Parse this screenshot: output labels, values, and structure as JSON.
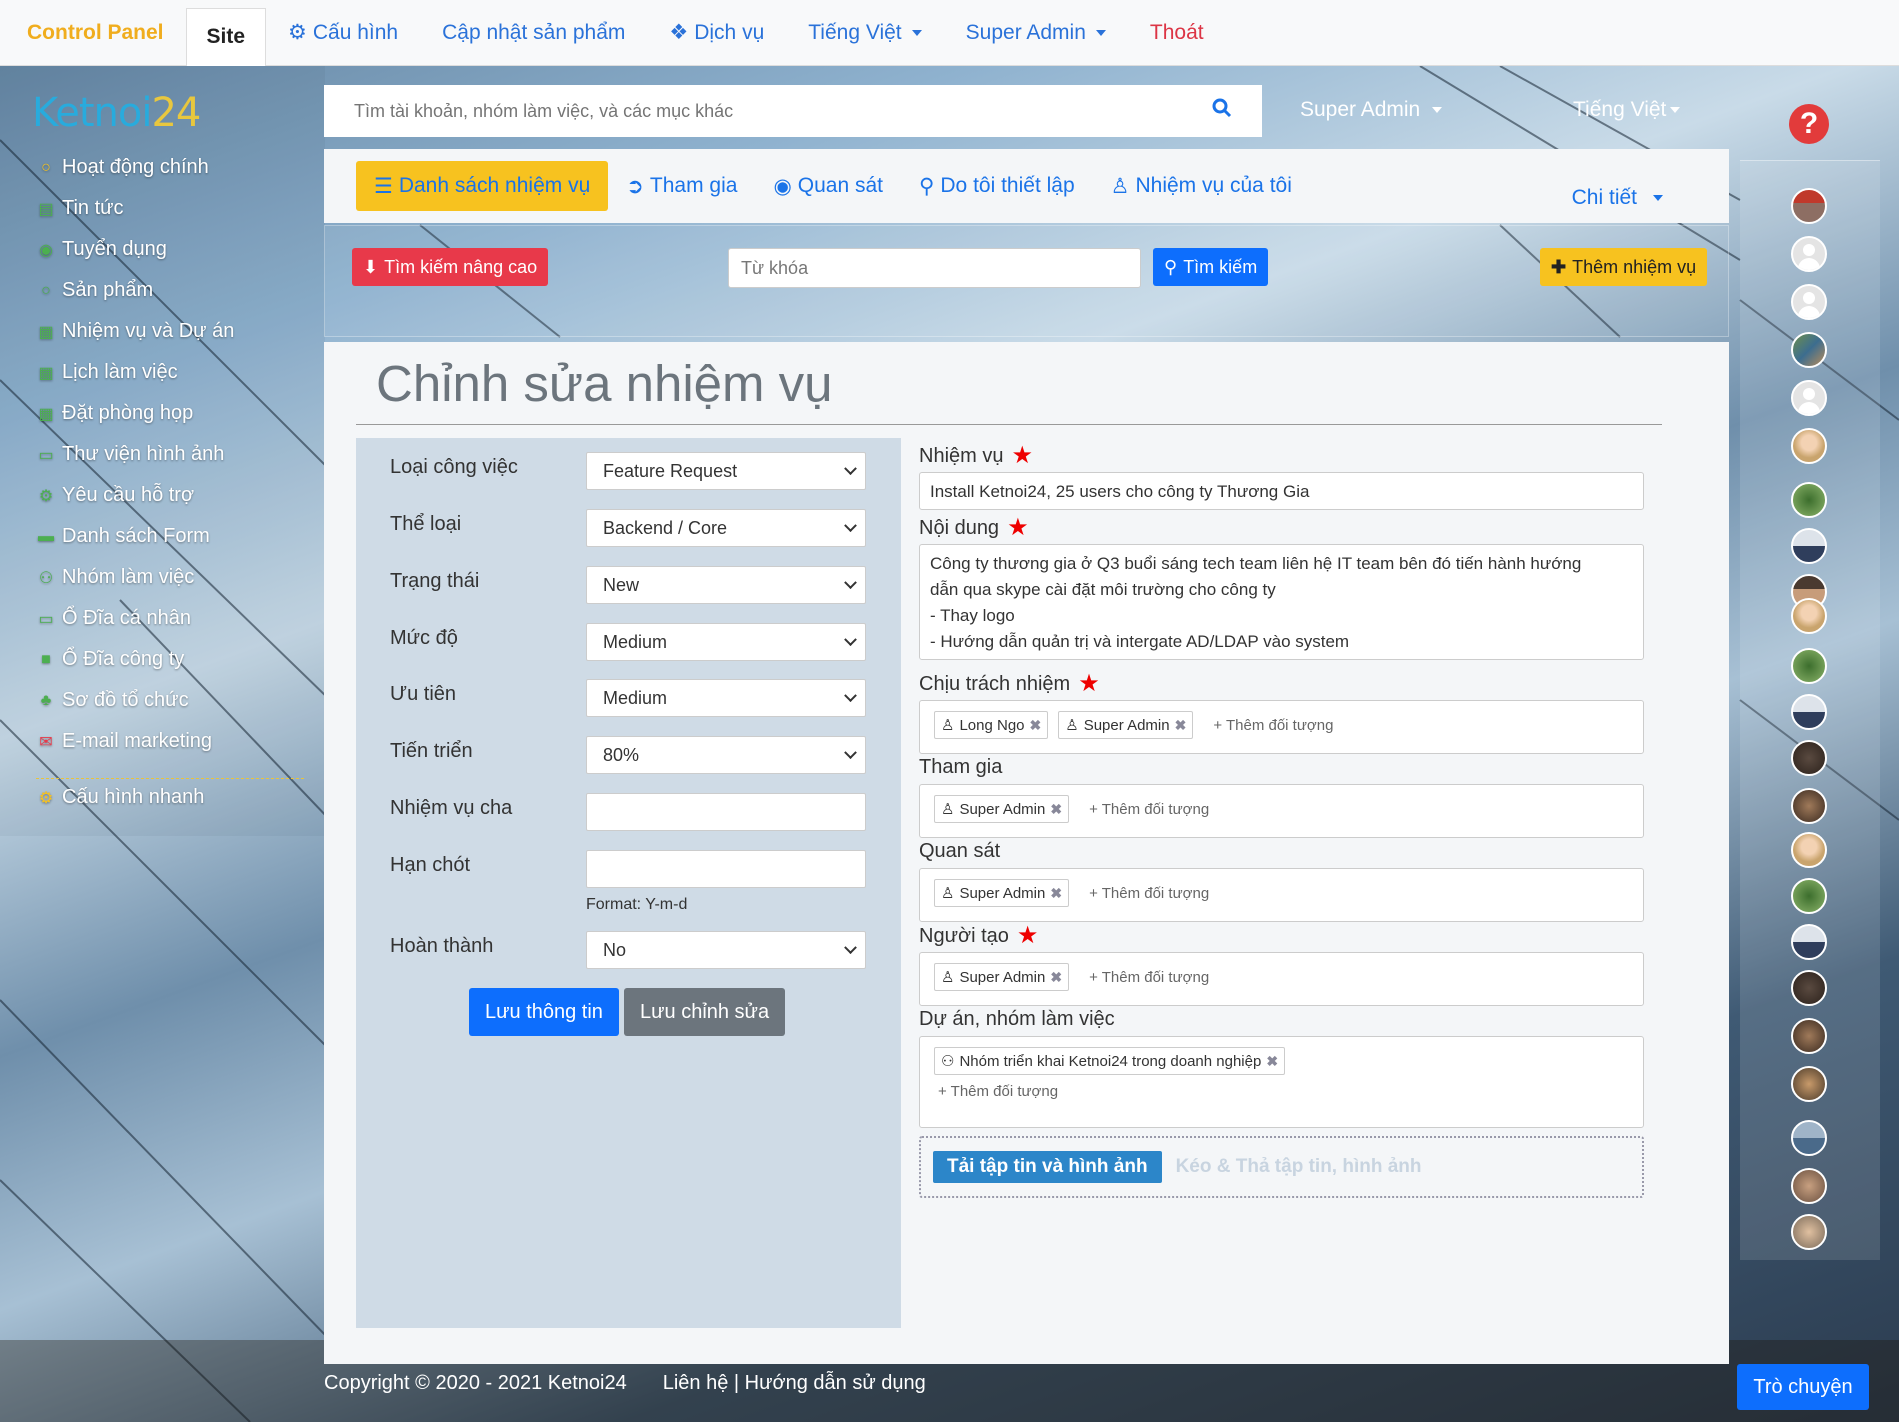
{
  "topnav": {
    "brand": "Control Panel",
    "items": [
      {
        "label": "Site"
      },
      {
        "label": "Cấu hình"
      },
      {
        "label": "Cập nhật sản phẩm"
      },
      {
        "label": "Dịch vụ"
      },
      {
        "label": "Tiếng Việt"
      },
      {
        "label": "Super Admin"
      },
      {
        "label": "Thoát"
      }
    ]
  },
  "logo": {
    "text": "Ketnoi",
    "num": "24"
  },
  "sidebar": {
    "items": [
      {
        "label": "Hoạt động chính",
        "icon": "circle-icon"
      },
      {
        "label": "Tin tức",
        "icon": "newspaper-icon"
      },
      {
        "label": "Tuyển dụng",
        "icon": "user-circle-icon"
      },
      {
        "label": "Sản phẩm",
        "icon": "circle-icon"
      },
      {
        "label": "Nhiệm vụ và Dự án",
        "icon": "calendar-icon"
      },
      {
        "label": "Lịch làm việc",
        "icon": "calendar-plus-icon"
      },
      {
        "label": "Đặt phòng họp",
        "icon": "calendar-grid-icon"
      },
      {
        "label": "Thư viện hình ảnh",
        "icon": "image-icon"
      },
      {
        "label": "Yêu cầu hỗ trợ",
        "icon": "gear-icon"
      },
      {
        "label": "Danh sách Form",
        "icon": "form-icon"
      },
      {
        "label": "Nhóm làm việc",
        "icon": "group-icon"
      },
      {
        "label": "Ổ Đĩa cá nhân",
        "icon": "folder-open-icon"
      },
      {
        "label": "Ổ Đĩa công ty",
        "icon": "folder-icon"
      },
      {
        "label": "Sơ đồ tổ chức",
        "icon": "sitemap-icon"
      },
      {
        "label": "E-mail marketing",
        "icon": "envelope-icon"
      },
      {
        "label": "Cấu hình nhanh",
        "icon": "gear-icon"
      }
    ]
  },
  "search": {
    "placeholder": "Tìm tài khoản, nhóm làm việc, và các mục khác"
  },
  "header_user": "Super Admin",
  "header_lang": "Tiếng Việt",
  "tabs": [
    {
      "label": "Danh sách nhiệm vụ"
    },
    {
      "label": "Tham gia"
    },
    {
      "label": "Quan sát"
    },
    {
      "label": "Do tôi thiết lập"
    },
    {
      "label": "Nhiệm vụ của tôi"
    }
  ],
  "tab_detail": "Chi tiết",
  "filter": {
    "advanced": "Tìm kiếm nâng cao",
    "keyword_placeholder": "Từ khóa",
    "search_button": "Tìm kiếm",
    "add_task": "Thêm nhiệm vụ"
  },
  "page_title": "Chỉnh sửa nhiệm vụ",
  "form_left": {
    "fields": [
      {
        "label": "Loại công việc",
        "value": "Feature Request"
      },
      {
        "label": "Thể loại",
        "value": "Backend / Core"
      },
      {
        "label": "Trạng thái",
        "value": "New"
      },
      {
        "label": "Mức độ",
        "value": "Medium"
      },
      {
        "label": "Ưu tiên",
        "value": "Medium"
      },
      {
        "label": "Tiến triển",
        "value": "80%"
      },
      {
        "label": "Nhiệm vụ cha",
        "value": ""
      },
      {
        "label": "Hạn chót",
        "value": ""
      },
      {
        "label": "Hoàn thành",
        "value": "No"
      }
    ],
    "deadline_hint": "Format: Y-m-d",
    "save_info": "Lưu thông tin",
    "save_edit": "Lưu chỉnh sửa"
  },
  "form_right": {
    "task_label": "Nhiệm vụ",
    "task_value": "Install Ketnoi24, 25 users cho công ty Thương Gia",
    "content_label": "Nội dung",
    "content_lines": [
      "Công ty thương gia ở Q3 buổi sáng tech team liên hệ IT team bên đó tiến hành hướng",
      "dẫn qua skype cài đặt môi trường cho công ty",
      "- Thay logo",
      "- Hướng dẫn quản trị và intergate AD/LDAP vào system"
    ],
    "responsible_label": "Chịu trách nhiệm",
    "responsible": [
      "Long Ngo",
      "Super Admin"
    ],
    "participants_label": "Tham gia",
    "participants": [
      "Super Admin"
    ],
    "observers_label": "Quan sát",
    "observers": [
      "Super Admin"
    ],
    "creator_label": "Người tạo",
    "creator": [
      "Super Admin"
    ],
    "project_label": "Dự án, nhóm làm việc",
    "project": "Nhóm triển khai Ketnoi24 trong doanh nghiệp",
    "add_object": "+ Thêm đối tượng",
    "upload_button": "Tải tập tin và hình ảnh",
    "drop_hint": "Kéo & Thả tập tin, hình ảnh"
  },
  "footer": {
    "copyright": "Copyright © 2020 - 2021 Ketnoi24",
    "links": "Liên hệ | Hướng dẫn sử dụng"
  },
  "chat_button": "Trò chuyện",
  "colors": {
    "brand": "#f0ad1e",
    "link": "#1a73e8",
    "accent_yellow": "#f7c21f",
    "danger": "#e8394a",
    "primary": "#0d6efd"
  }
}
